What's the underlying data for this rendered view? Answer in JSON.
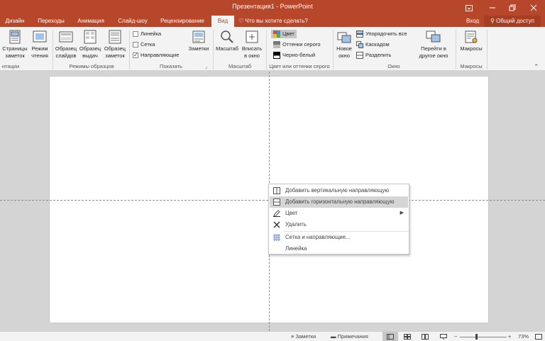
{
  "window": {
    "title": "Презентация1 - PowerPoint"
  },
  "tabs": [
    "Дизайн",
    "Переходы",
    "Анимация",
    "Слайд-шоу",
    "Рецензирование",
    "Вид"
  ],
  "tell_me": "Что вы хотите сделать?",
  "signin": "Вход",
  "share": "Общий доступ",
  "ribbon": {
    "views": {
      "notes_page": "Страницы\nзаметок",
      "reading": "Режим\nчтения",
      "label": "нтации"
    },
    "masters": {
      "slide_master": "Образец\nслайдов",
      "handout_master": "Образец\nвыдач",
      "notes_master": "Образец\nзаметок",
      "label": "Режимы образцов"
    },
    "show": {
      "ruler": "Линейка",
      "gridlines": "Сетка",
      "guides": "Направляющие",
      "notes": "Заметки",
      "label": "Показать"
    },
    "zoom": {
      "zoom": "Масштаб",
      "fit": "Вписать\nв окно",
      "label": "Масштаб"
    },
    "color": {
      "color": "Цвет",
      "grayscale": "Оттенки серого",
      "bw": "Черно-белый",
      "label": "Цвет или оттенки серого"
    },
    "window": {
      "new_window": "Новое\nокно",
      "arrange": "Упорядочить все",
      "cascade": "Каскадом",
      "split": "Разделить",
      "switch": "Перейти в\nдругое окно",
      "label": "Окно"
    },
    "macros": {
      "macros": "Макросы",
      "label": "Макросы"
    }
  },
  "context_menu": {
    "items": [
      "Добавить вертикальную направляющую",
      "Добавить горизонтальную направляющую",
      "Цвет",
      "Удалить",
      "Сетка и направляющие...",
      "Линейка"
    ]
  },
  "status": {
    "notes": "Заметки",
    "comments": "Примечания",
    "zoom": "73%",
    "zoom_level": 0.73
  },
  "colors": {
    "accent": "#b7472a",
    "ribbon": "#f3f3f3",
    "workspace": "#d4d4d4"
  }
}
